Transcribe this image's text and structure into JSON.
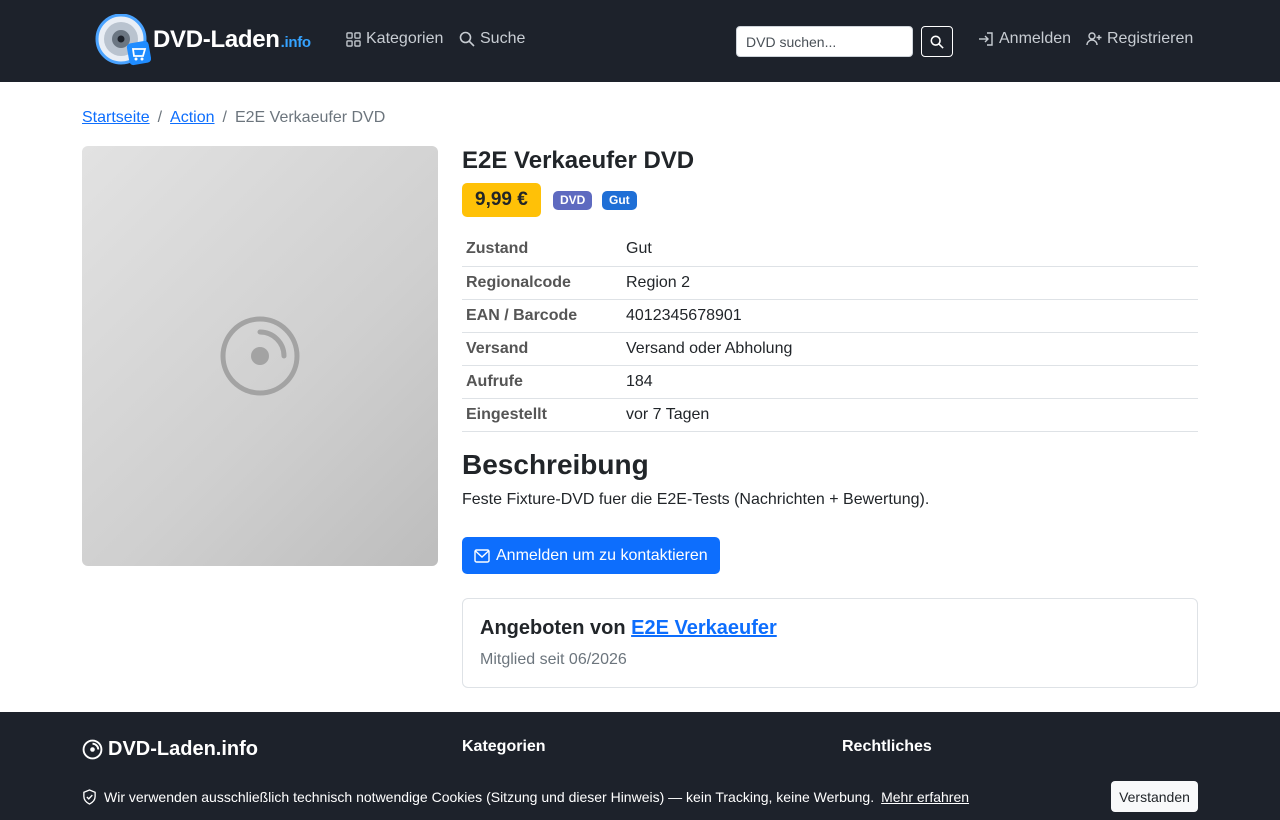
{
  "brand": {
    "name": "DVD-Laden",
    "suffix": ".info",
    "accent": "#35a3ff"
  },
  "nav": {
    "categories": "Kategorien",
    "search": "Suche",
    "search_placeholder": "DVD suchen...",
    "login": "Anmelden",
    "register": "Registrieren"
  },
  "breadcrumb": {
    "home": "Startseite",
    "category": "Action",
    "current": "E2E Verkaeufer DVD"
  },
  "product": {
    "title": "E2E Verkaeufer DVD",
    "price": "9,99 €",
    "badges": [
      "DVD",
      "Gut"
    ],
    "details": [
      {
        "key": "Zustand",
        "value": "Gut"
      },
      {
        "key": "Regionalcode",
        "value": "Region 2"
      },
      {
        "key": "EAN / Barcode",
        "value": "4012345678901"
      },
      {
        "key": "Versand",
        "value": "Versand oder Abholung"
      },
      {
        "key": "Aufrufe",
        "value": "184"
      },
      {
        "key": "Eingestellt",
        "value": "vor 7 Tagen"
      }
    ],
    "description_heading": "Beschreibung",
    "description": "Feste Fixture-DVD fuer die E2E-Tests (Nachrichten + Bewertung).",
    "contact_button": "Anmelden um zu kontaktieren"
  },
  "seller": {
    "prefix": "Angeboten von",
    "name": "E2E Verkaeufer",
    "since": "Mitglied seit 06/2026"
  },
  "footer": {
    "brand": "DVD-Laden.info",
    "col1": "Kategorien",
    "col2": "Rechtliches"
  },
  "cookie": {
    "text": "Wir verwenden ausschließlich technisch notwendige Cookies (Sitzung und dieser Hinweis) — kein Tracking, keine Werbung.",
    "link": "Mehr erfahren",
    "button": "Verstanden"
  }
}
